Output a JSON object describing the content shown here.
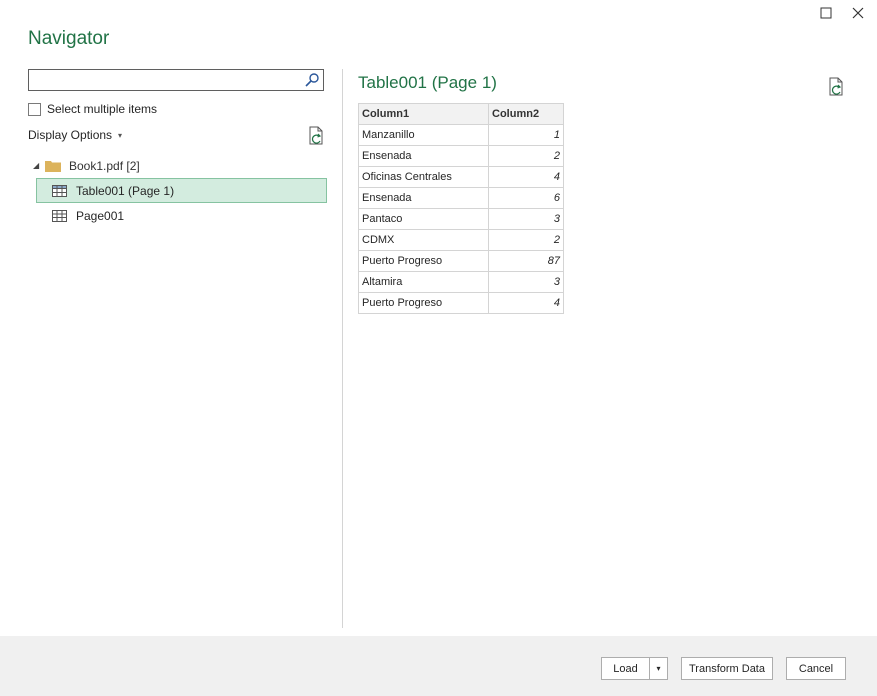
{
  "window": {
    "title": "Navigator",
    "maximize_icon": "maximize-icon",
    "close_icon": "close-icon"
  },
  "left": {
    "search": {
      "value": "",
      "placeholder": ""
    },
    "select_multiple_label": "Select multiple items",
    "select_multiple_checked": false,
    "display_options_label": "Display Options",
    "tree": {
      "root_label": "Book1.pdf [2]",
      "items": [
        {
          "label": "Table001 (Page 1)",
          "selected": true
        },
        {
          "label": "Page001",
          "selected": false
        }
      ]
    }
  },
  "preview": {
    "title": "Table001 (Page 1)",
    "headers": [
      "Column1",
      "Column2"
    ],
    "rows": [
      [
        "Manzanillo",
        "1"
      ],
      [
        "Ensenada",
        "2"
      ],
      [
        "Oficinas Centrales",
        "4"
      ],
      [
        "Ensenada",
        "6"
      ],
      [
        "Pantaco",
        "3"
      ],
      [
        "CDMX",
        "2"
      ],
      [
        "Puerto Progreso",
        "87"
      ],
      [
        "Altamira",
        "3"
      ],
      [
        "Puerto Progreso",
        "4"
      ]
    ]
  },
  "footer": {
    "load_label": "Load",
    "load_dropdown_glyph": "▾",
    "transform_label": "Transform Data",
    "cancel_label": "Cancel"
  },
  "colors": {
    "accent": "#217346",
    "selected_bg": "#d3ecdf",
    "footer_bg": "#f0f0f0"
  }
}
